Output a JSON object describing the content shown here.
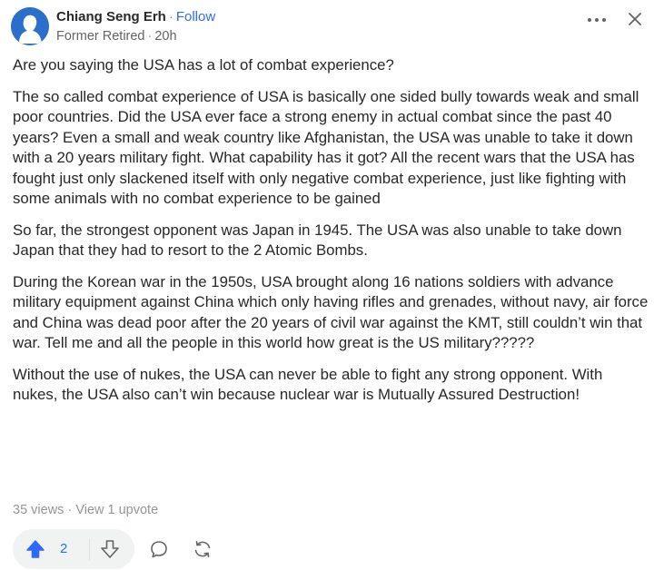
{
  "header": {
    "author_name": "Chiang Seng Erh",
    "separator": "·",
    "follow_label": "Follow",
    "credential": "Former Retired",
    "time_ago": "20h"
  },
  "content": {
    "paragraphs": [
      "Are you saying the USA has a lot of combat experience?",
      "The so called combat experience of USA is basically one sided bully towards weak and small poor countries. Did the USA ever face a strong enemy in actual combat since the past 40 years? Even a small and weak country like Afghanistan, the USA was unable to take it down with a 20 years military fight. What capability has it got? All the recent wars that the USA has fought just only slackened itself with only negative combat experience, just like fighting with some animals with no combat experience to be gained",
      "So far, the strongest opponent was Japan in 1945. The USA was also unable to take down Japan that they had to resort to the 2 Atomic Bombs.",
      "During the Korean war in the 1950s, USA brought along 16 nations soldiers with advance military equipment against China which only having rifles and grenades, without navy, air force and China was dead poor after the 20 years of civil war against the KMT, still couldn’t win that war. Tell me and all the people in this world how great is the US military?????",
      "Without the use of nukes, the USA can never be able to fight any strong opponent. With nukes, the USA also can’t win because nuclear war is Mutually Assured Destruction!"
    ]
  },
  "stats": {
    "views": "35 views",
    "separator": "·",
    "upvote_link": "View 1 upvote"
  },
  "actions": {
    "upvote_count": "2"
  },
  "icons": {
    "more": "more-dots-icon",
    "close": "close-icon",
    "upvote": "upvote-arrow-icon",
    "downvote": "downvote-arrow-icon",
    "comment": "comment-bubble-icon",
    "share": "reshare-icon"
  },
  "colors": {
    "accent": "#2e69ff",
    "text": "#282829",
    "muted": "#636466",
    "light_muted": "#939598",
    "avatar_bg": "#2c6ecb"
  }
}
